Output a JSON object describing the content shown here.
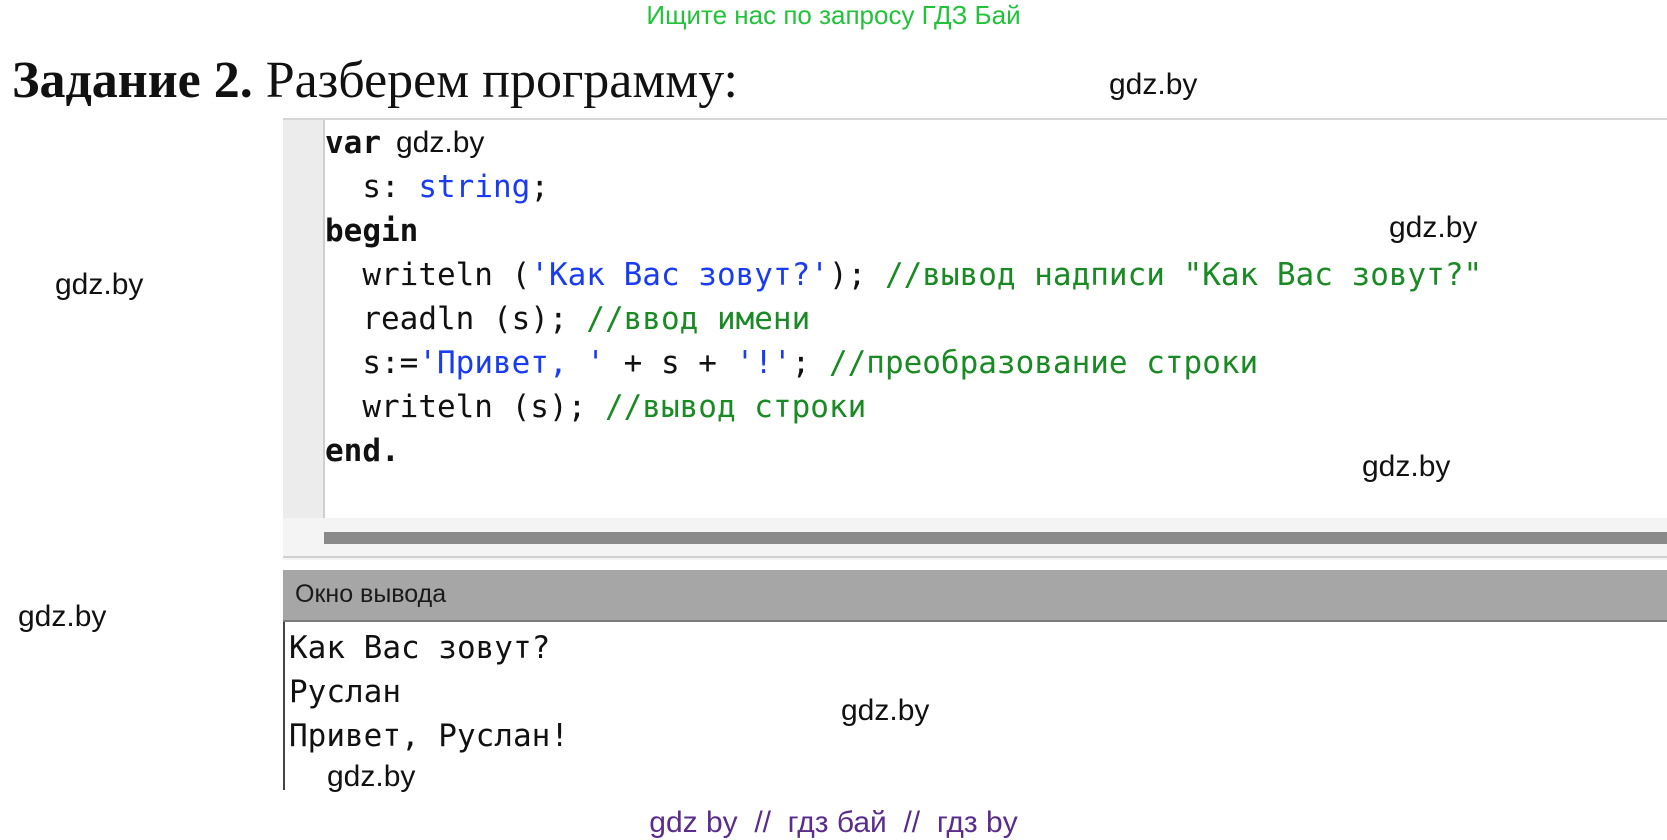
{
  "top_banner": "Ищите нас по запросу ГДЗ Бай",
  "task": {
    "label": "Задание 2.",
    "text": " Разберем программу:"
  },
  "code": {
    "line1_kw": "var",
    "line2_indent": "  s: ",
    "line2_type": "string",
    "line2_end": ";",
    "line3_kw": "begin",
    "line4_code": "  writeln (",
    "line4_str": "'Как Вас зовут?'",
    "line4_end": "); ",
    "line4_comment": "//вывод надписи \"Как Вас зовут?\"",
    "line5_code": "  readln (s); ",
    "line5_comment": "//ввод имени",
    "line6_code": "  s:=",
    "line6_str1": "'Привет, '",
    "line6_mid": " + s + ",
    "line6_str2": "'!'",
    "line6_end": "; ",
    "line6_comment": "//преобразование строки",
    "line7_code": "  writeln (s); ",
    "line7_comment": "//вывод строки",
    "line8_kw": "end."
  },
  "output": {
    "title": "Окно вывода",
    "lines": [
      "Как Вас зовут?",
      "Руслан",
      "Привет, Руслан!"
    ]
  },
  "watermarks": [
    "gdz.by",
    "gdz.by",
    "gdz.by",
    "gdz.by",
    "gdz.by",
    "gdz.by",
    "gdz.by",
    "gdz.by"
  ],
  "bottom_banner": "gdz by  //  гдз бай  //  гдз by"
}
